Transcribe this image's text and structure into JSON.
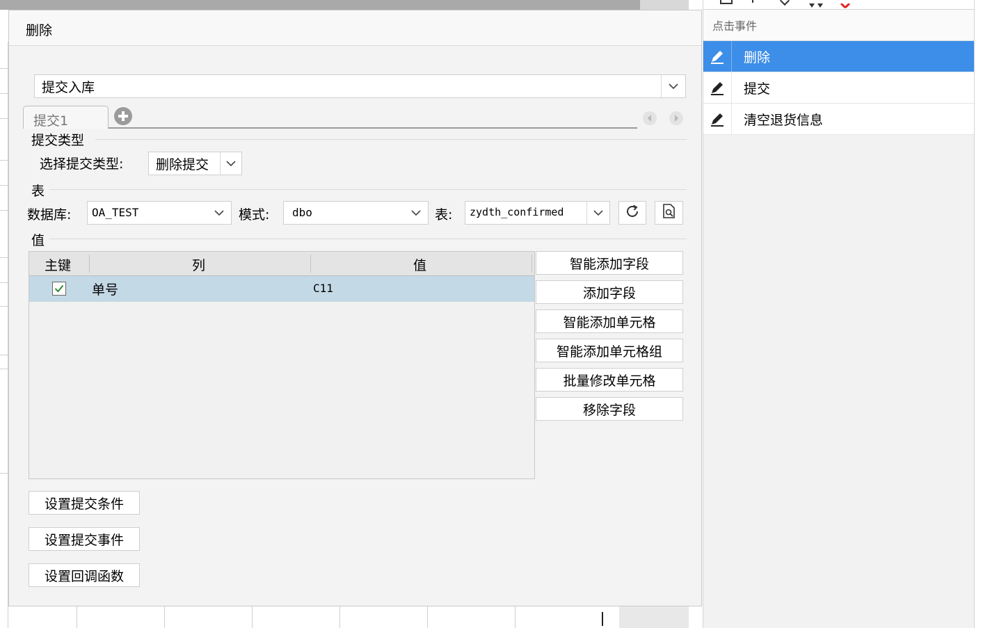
{
  "dialog": {
    "title": "删除",
    "submit_combo": {
      "value": "提交入库"
    },
    "tab": {
      "label": "提交1"
    },
    "submit_type": {
      "section_label": "提交类型",
      "field_label": "选择提交类型:",
      "value": "删除提交"
    },
    "table_section": {
      "section_label": "表",
      "database_label": "数据库:",
      "database_value": "OA_TEST",
      "schema_label": "模式:",
      "schema_value": "dbo",
      "table_label": "表:",
      "table_value": "zydth_confirmed"
    },
    "values_section": {
      "section_label": "值",
      "columns": [
        "主键",
        "列",
        "值"
      ],
      "rows": [
        {
          "primary_key": true,
          "column": "单号",
          "value": "C11"
        }
      ]
    },
    "side_buttons": [
      "智能添加字段",
      "添加字段",
      "智能添加单元格",
      "智能添加单元格组",
      "批量修改单元格",
      "移除字段"
    ],
    "bottom_buttons": [
      "设置提交条件",
      "设置提交事件",
      "设置回调函数"
    ]
  },
  "events_panel": {
    "header": "点击事件",
    "items": [
      {
        "label": "删除",
        "selected": true,
        "icon": "pencil-icon"
      },
      {
        "label": "提交",
        "selected": false,
        "icon": "pencil-icon"
      },
      {
        "label": "清空退货信息",
        "selected": false,
        "icon": "pencil-icon"
      }
    ]
  },
  "colors": {
    "selection": "#3d8ee8",
    "row_highlight": "#c4d9e6",
    "check": "#2e8b2e"
  }
}
